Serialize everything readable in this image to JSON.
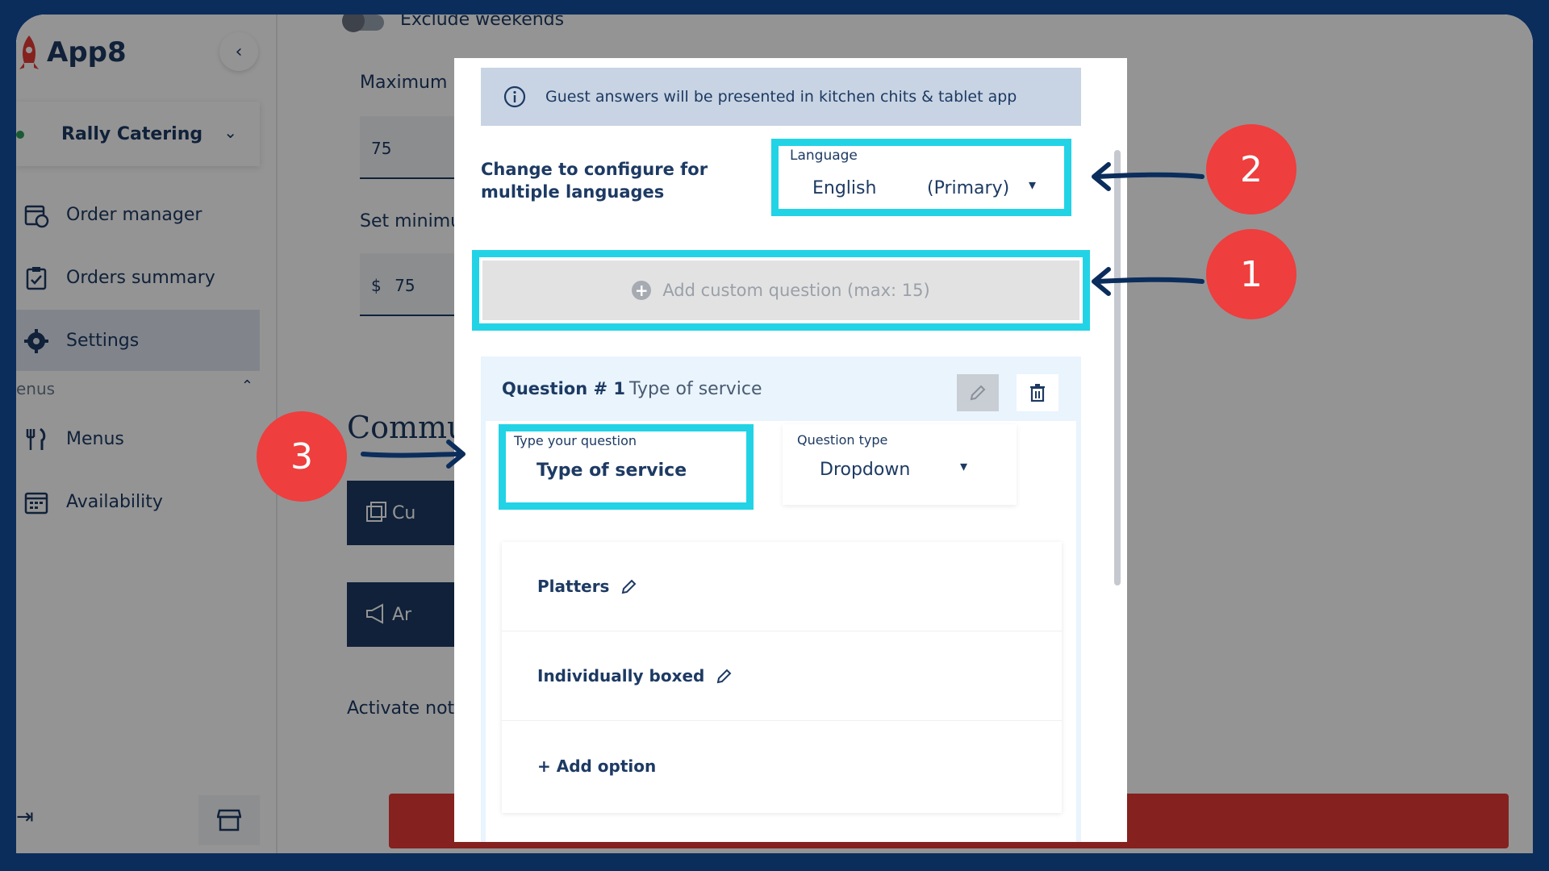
{
  "app": {
    "name": "App8"
  },
  "sidebar": {
    "restaurant": "Rally Catering",
    "items": [
      {
        "label": "Order manager",
        "icon": "calendar-clock-icon"
      },
      {
        "label": "Orders summary",
        "icon": "clipboard-check-icon"
      },
      {
        "label": "Settings",
        "icon": "gear-icon",
        "active": true
      }
    ],
    "section_label": "enus",
    "section_items": [
      {
        "label": "Menus",
        "icon": "fork-knife-icon"
      },
      {
        "label": "Availability",
        "icon": "calendar-icon"
      }
    ]
  },
  "main": {
    "exclude_weekends": "Exclude weekends",
    "maximum_label": "Maximum i",
    "maximum_value": "75",
    "minimum_label": "Set minimu",
    "currency": "$",
    "minimum_value": "75",
    "heading": "Commu",
    "btn1": "Cu",
    "btn2": "Ar",
    "activate_label": "Activate noti"
  },
  "modal": {
    "info": "Guest answers will be presented in kitchen chits & tablet app",
    "configure_label": "Change to configure for multiple languages",
    "language": {
      "label": "Language",
      "value": "English",
      "tag": "(Primary)"
    },
    "add_question": "Add custom question (max: 15)",
    "question": {
      "number": "Question # 1",
      "title": "Type of service",
      "input_label": "Type your question",
      "input_value": "Type of service",
      "type_label": "Question type",
      "type_value": "Dropdown",
      "options": [
        "Platters",
        "Individually boxed"
      ],
      "add_option": "+ Add option"
    }
  },
  "annotations": [
    "1",
    "2",
    "3"
  ],
  "colors": {
    "highlight": "#22d3e6",
    "marker": "#ee3e3e",
    "navy": "#1d3a63",
    "frame": "#0b2d5c"
  }
}
